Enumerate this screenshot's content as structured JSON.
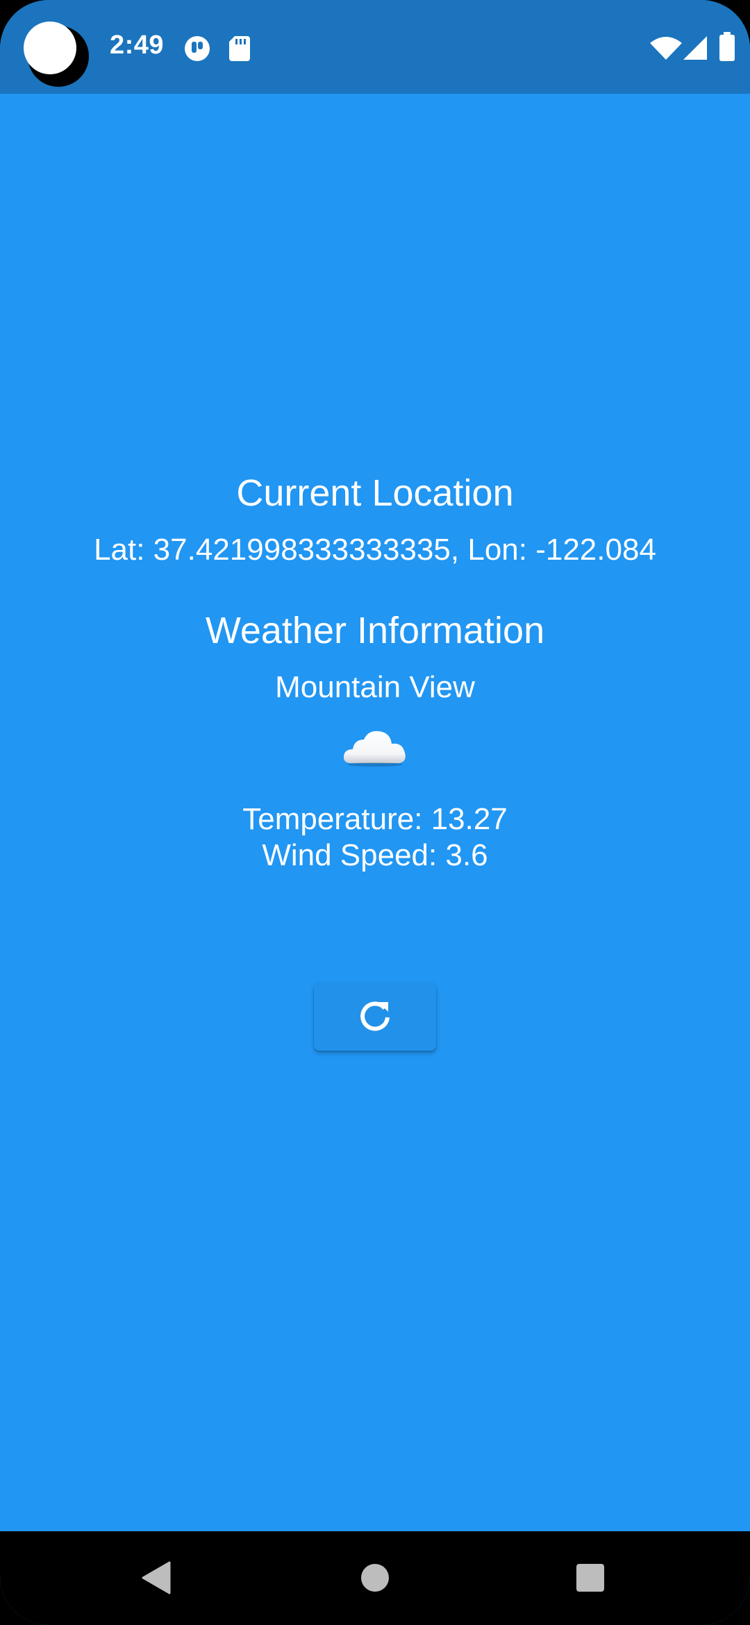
{
  "status_bar": {
    "time": "2:49",
    "icons": [
      "notification-app-icon",
      "sd-card-icon",
      "wifi-icon",
      "cell-signal-icon",
      "battery-icon"
    ]
  },
  "location": {
    "title": "Current Location",
    "coords": "Lat: 37.421998333333335,  Lon: -122.084"
  },
  "weather": {
    "title": "Weather Information",
    "city": "Mountain View",
    "icon": "cloud-icon",
    "temperature": "Temperature: 13.27",
    "wind_speed": "Wind Speed: 3.6"
  },
  "refresh_button": {
    "icon": "refresh-icon"
  },
  "nav_bar": {
    "buttons": [
      "back-icon",
      "home-icon",
      "recents-icon"
    ]
  },
  "colors": {
    "background": "#2196F3",
    "status_bar": "#1B74BD",
    "button": "#2191E9",
    "text": "#FFFFFF"
  }
}
